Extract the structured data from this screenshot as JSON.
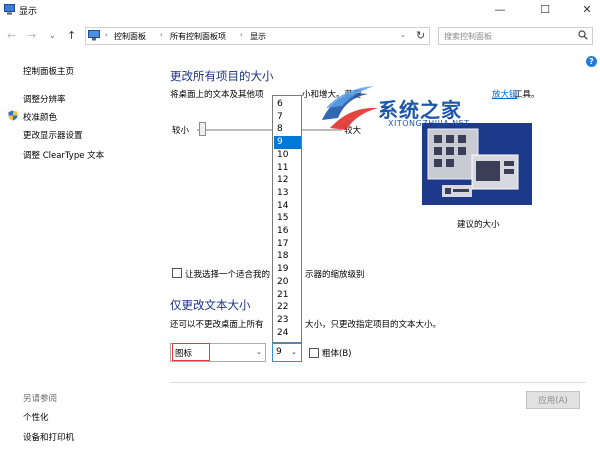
{
  "window": {
    "title": "显示",
    "minimize": "—",
    "maximize": "☐",
    "close": "✕"
  },
  "nav": {
    "back": "←",
    "forward": "→",
    "dropdown": "⌄",
    "up": "↑",
    "breadcrumbs": [
      "控制面板",
      "所有控制面板项",
      "显示"
    ],
    "crumb_separator": "›",
    "refresh": "↻",
    "search_placeholder": "搜索控制面板"
  },
  "help": "?",
  "sidebar": {
    "items": [
      {
        "label": "控制面板主页"
      },
      {
        "label": "调整分辨率"
      },
      {
        "label": "校准颜色"
      },
      {
        "label": "更改显示器设置"
      },
      {
        "label": "调整 ClearType 文本"
      }
    ],
    "see_also": "另请参阅",
    "see_also_items": [
      {
        "label": "个性化"
      },
      {
        "label": "设备和打印机"
      }
    ]
  },
  "main": {
    "heading": "更改所有项目的大小",
    "desc": "将桌面上的文本及其他项",
    "desc_mid": "小和增大。若要",
    "magnifier_link": "放大镜",
    "desc_tail": "工具。",
    "slider": {
      "small": "较小",
      "large": "较大",
      "level": 0
    },
    "preview_label": "建议的大小",
    "custom_check_label": "让我选择一个适合我的",
    "custom_check_tail": "示器的缩放级别",
    "text_heading": "仅更改文本大小",
    "text_desc": "还可以不更改桌面上所有",
    "text_desc_tail": "大小，只更改指定项目的文本大小。",
    "item_select_value": "图标",
    "size_select_value": "9",
    "bold_label": "粗体(B)",
    "apply": "应用(A)"
  },
  "size_dropdown": {
    "options": [
      "6",
      "7",
      "8",
      "9",
      "10",
      "11",
      "12",
      "13",
      "14",
      "15",
      "16",
      "17",
      "18",
      "19",
      "20",
      "21",
      "22",
      "23",
      "24"
    ],
    "selected": "9"
  },
  "watermark": {
    "text": "系统之家",
    "sub": "XITONGZHIJIA.NET"
  },
  "colors": {
    "heading": "#1e3287",
    "link": "#0066cc",
    "selection": "#0078d7",
    "highlight_border": "#e23a3a",
    "preview_bg": "#1d3a8a"
  }
}
